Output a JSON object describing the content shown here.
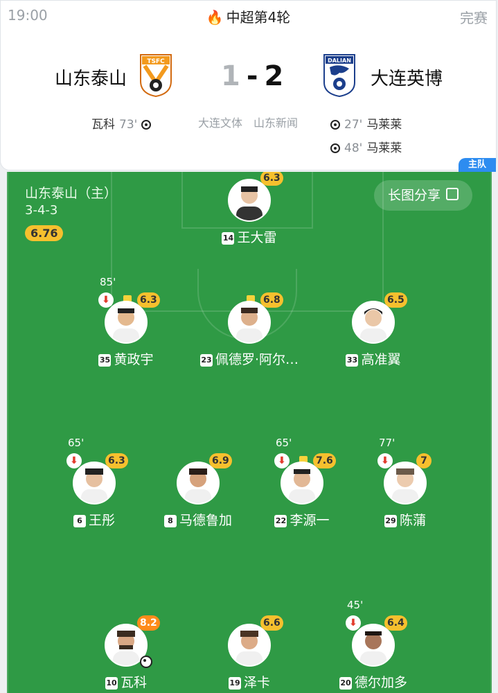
{
  "header": {
    "time": "19:00",
    "round": "中超第4轮",
    "status": "完赛",
    "home_team": "山东泰山",
    "away_team": "大连英博",
    "home_score": "1",
    "away_score": "2",
    "home_badge_text": "TSFC",
    "away_badge_text": "DALIAN",
    "home_events": [
      {
        "player": "瓦科",
        "minute": "73'"
      }
    ],
    "away_events": [
      {
        "player": "马莱莱",
        "minute": "27'"
      },
      {
        "player": "马莱莱",
        "minute": "48'"
      }
    ],
    "sources": [
      "大连文体",
      "山东新闻"
    ],
    "home_tab": "主队"
  },
  "pitch": {
    "team_label": "山东泰山（主）",
    "formation": "3-4-3",
    "team_rating": "6.76",
    "share_label": "长图分享",
    "players": [
      {
        "number": "14",
        "name": "王大雷",
        "rating": "6.3"
      },
      {
        "number": "35",
        "name": "黄政宇",
        "rating": "6.3",
        "sub_minute": "85'"
      },
      {
        "number": "23",
        "name": "佩德罗·阿尔…",
        "rating": "6.8"
      },
      {
        "number": "33",
        "name": "高准翼",
        "rating": "6.5"
      },
      {
        "number": "6",
        "name": "王彤",
        "rating": "6.3",
        "sub_minute": "65'"
      },
      {
        "number": "8",
        "name": "马德鲁加",
        "rating": "6.9"
      },
      {
        "number": "22",
        "name": "李源一",
        "rating": "7.6",
        "sub_minute": "65'"
      },
      {
        "number": "29",
        "name": "陈蒲",
        "rating": "7",
        "sub_minute": "77'"
      },
      {
        "number": "10",
        "name": "瓦科",
        "rating": "8.2"
      },
      {
        "number": "19",
        "name": "泽卡",
        "rating": "6.6"
      },
      {
        "number": "20",
        "name": "德尔加多",
        "rating": "6.4",
        "sub_minute": "45'"
      }
    ]
  },
  "colors": {
    "pitch": "#2f9a45",
    "rating": "#f6c02e",
    "rating_high": "#ff8c1a",
    "accent": "#2d8cf0"
  }
}
